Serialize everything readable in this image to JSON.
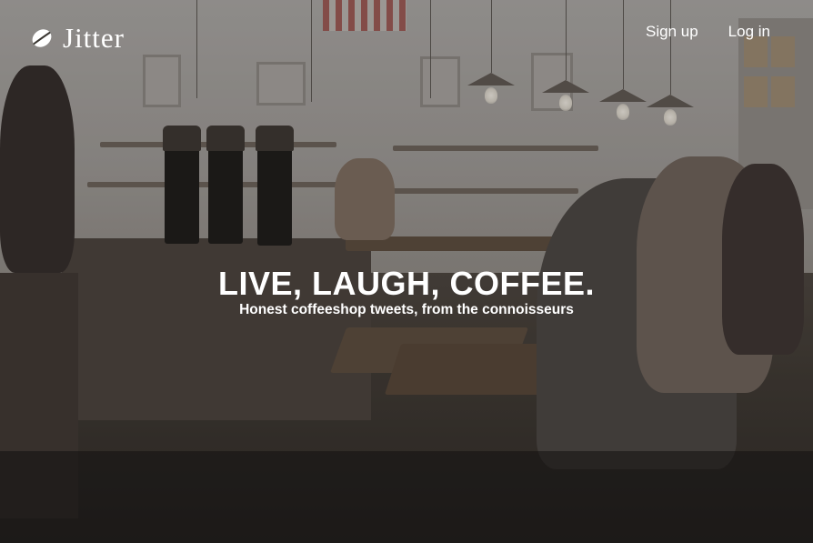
{
  "brand": {
    "name": "Jitter",
    "logo_icon": "coffee-bean-icon"
  },
  "nav": {
    "signup_label": "Sign up",
    "login_label": "Log in"
  },
  "hero": {
    "headline": "LIVE, LAUGH, COFFEE.",
    "tagline": "Honest coffeeshop tweets, from the connoisseurs"
  },
  "background": {
    "description_icon": "coffee-shop-photo",
    "text_color": "#ffffff"
  }
}
